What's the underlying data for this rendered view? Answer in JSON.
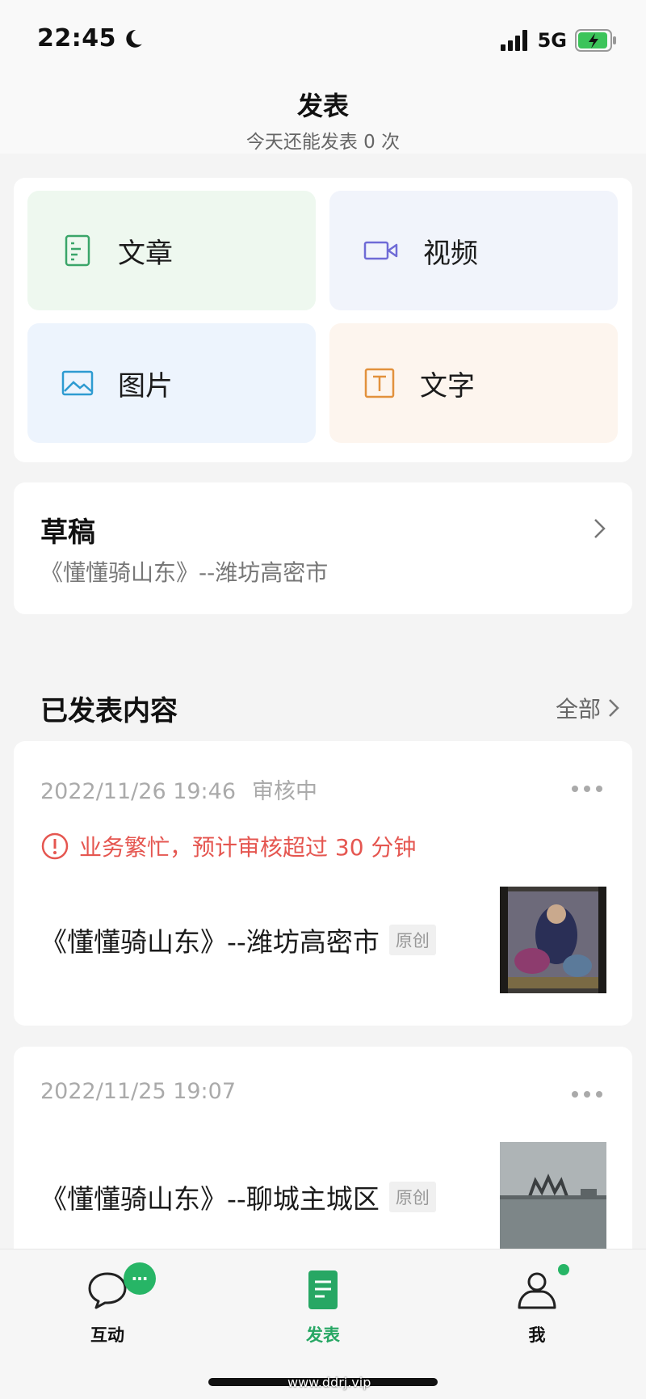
{
  "status_bar": {
    "time": "22:45",
    "network": "5G"
  },
  "header": {
    "title": "发表",
    "subtitle": "今天还能发表 0 次"
  },
  "publish_options": {
    "article": "文章",
    "video": "视频",
    "image": "图片",
    "text": "文字"
  },
  "draft": {
    "title": "草稿",
    "subtitle": "《懂懂骑山东》--潍坊高密市"
  },
  "published_section": {
    "title": "已发表内容",
    "all_label": "全部"
  },
  "posts": [
    {
      "date": "2022/11/26 19:46",
      "status": "审核中",
      "alert": "业务繁忙，预计审核超过 30 分钟",
      "title": "《懂懂骑山东》--潍坊高密市",
      "badge": "原创"
    },
    {
      "date": "2022/11/25 19:07",
      "title": "《懂懂骑山东》--聊城主城区",
      "badge": "原创"
    }
  ],
  "tab_bar": {
    "interact": "互动",
    "interact_badge": "…",
    "publish": "发表",
    "me": "我"
  },
  "watermark": "www.ddrj.vip",
  "colors": {
    "accent": "#27a764",
    "alert": "#e55650"
  }
}
